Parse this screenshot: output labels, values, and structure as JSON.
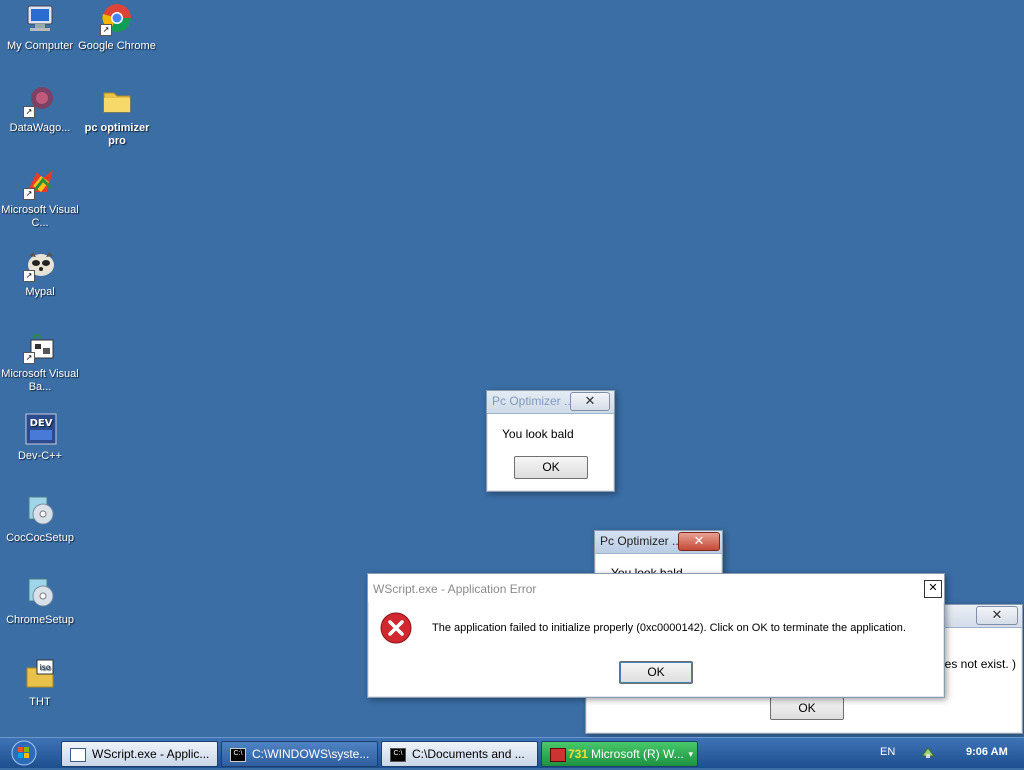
{
  "desktop": {
    "icons": [
      {
        "label": "My Computer",
        "icon": "computer-icon"
      },
      {
        "label": "Google Chrome",
        "icon": "chrome-icon"
      },
      {
        "label": "DataWago...",
        "icon": "datawago-icon"
      },
      {
        "label": "pc optimizer pro",
        "icon": "folder-icon"
      },
      {
        "label": "Microsoft Visual C...",
        "icon": "visual-c-icon"
      },
      {
        "label": "Mypal",
        "icon": "mypal-icon"
      },
      {
        "label": "Microsoft Visual Ba...",
        "icon": "visual-basic-icon"
      },
      {
        "label": "Dev-C++",
        "icon": "devcpp-icon"
      },
      {
        "label": "CocCocSetup",
        "icon": "setup-icon"
      },
      {
        "label": "ChromeSetup",
        "icon": "setup-icon"
      },
      {
        "label": "THT",
        "icon": "iso-folder-icon"
      }
    ]
  },
  "dialog_bald_1": {
    "title": "Pc Optimizer ...",
    "close": "✕",
    "message": "You look bald",
    "ok": "OK"
  },
  "dialog_bald_2": {
    "title": "Pc Optimizer ...",
    "close": "✕",
    "message": "You look bald"
  },
  "dialog_back": {
    "close": "✕",
    "message_fragment": "oes not exist. )",
    "ok": "OK"
  },
  "error_dialog": {
    "title": "WScript.exe - Application Error",
    "close": "✕",
    "message": "The application failed to initialize properly (0xc0000142). Click on OK to terminate the application.",
    "ok": "OK",
    "icon": "error-icon"
  },
  "taskbar": {
    "tasks": [
      {
        "label": "WScript.exe - Applic...",
        "icon": "window-icon",
        "state": "active"
      },
      {
        "label": "C:\\WINDOWS\\syste...",
        "icon": "cmd-icon",
        "state": "normal"
      },
      {
        "label": "C:\\Documents and ...",
        "icon": "cmd-icon",
        "state": "active"
      },
      {
        "label": "Microsoft (R) W...",
        "icon": "wscript-icon",
        "state": "green",
        "count": "731"
      }
    ],
    "language": "EN",
    "time": "9:06 AM"
  },
  "colors": {
    "desktop_bg": "#3a6ea5",
    "error_red": "#d0282e",
    "taskbar_green": "#2aa84e"
  }
}
